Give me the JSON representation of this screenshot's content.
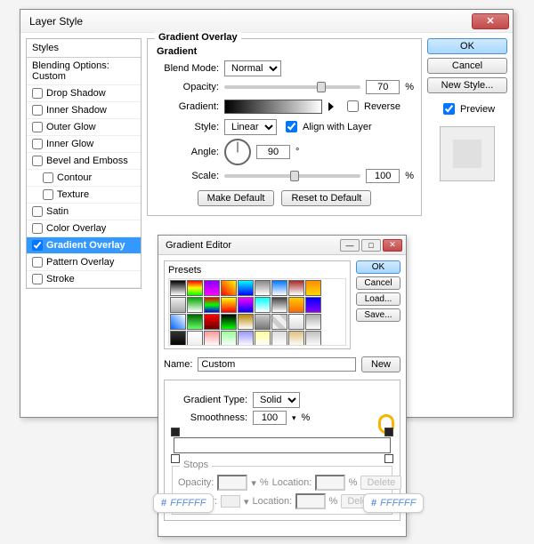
{
  "main": {
    "title": "Layer Style",
    "styles_head": "Styles",
    "blending": "Blending Options: Custom",
    "items": [
      {
        "label": "Drop Shadow",
        "checked": false
      },
      {
        "label": "Inner Shadow",
        "checked": false
      },
      {
        "label": "Outer Glow",
        "checked": false
      },
      {
        "label": "Inner Glow",
        "checked": false
      },
      {
        "label": "Bevel and Emboss",
        "checked": false
      },
      {
        "label": "Contour",
        "checked": false,
        "sub": true
      },
      {
        "label": "Texture",
        "checked": false,
        "sub": true
      },
      {
        "label": "Satin",
        "checked": false
      },
      {
        "label": "Color Overlay",
        "checked": false
      },
      {
        "label": "Gradient Overlay",
        "checked": true,
        "selected": true
      },
      {
        "label": "Pattern Overlay",
        "checked": false
      },
      {
        "label": "Stroke",
        "checked": false
      }
    ],
    "section_title": "Gradient Overlay",
    "section_sub": "Gradient",
    "blend_mode_lbl": "Blend Mode:",
    "blend_mode": "Normal",
    "opacity_lbl": "Opacity:",
    "opacity_val": "70",
    "gradient_lbl": "Gradient:",
    "reverse_lbl": "Reverse",
    "style_lbl": "Style:",
    "style_val": "Linear",
    "align_lbl": "Align with Layer",
    "angle_lbl": "Angle:",
    "angle_val": "90",
    "scale_lbl": "Scale:",
    "scale_val": "100",
    "make_default": "Make Default",
    "reset_default": "Reset to Default",
    "ok": "OK",
    "cancel": "Cancel",
    "new_style": "New Style...",
    "preview_lbl": "Preview",
    "pct": "%",
    "deg": "°"
  },
  "ge": {
    "title": "Gradient Editor",
    "presets_lbl": "Presets",
    "ok": "OK",
    "cancel": "Cancel",
    "load": "Load...",
    "save": "Save...",
    "name_lbl": "Name:",
    "name_val": "Custom",
    "new_btn": "New",
    "gtype_lbl": "Gradient Type:",
    "gtype_val": "Solid",
    "smooth_lbl": "Smoothness:",
    "smooth_val": "100",
    "stops_title": "Stops",
    "opacity_lbl": "Opacity:",
    "location_lbl": "Location:",
    "color_lbl": "Color:",
    "delete_lbl": "Delete",
    "pct": "%",
    "swatches": [
      "linear-gradient(#000,#fff)",
      "linear-gradient(#f00,#ff0,#0f0)",
      "linear-gradient(#80f,#f0f)",
      "linear-gradient(45deg,#f00,#ff0)",
      "linear-gradient(#0ff,#00f)",
      "linear-gradient(#888,#fff)",
      "linear-gradient(#07f,#fff)",
      "linear-gradient(#a52a2a,#fff)",
      "linear-gradient(#ff8c00,#ffd700)",
      "linear-gradient(#eee,#aaa)",
      "linear-gradient(#0a0,#fff)",
      "linear-gradient(#f00,#0f0,#00f)",
      "linear-gradient(#ff0,#f00)",
      "linear-gradient(#f0f,#00f)",
      "linear-gradient(#0ff,#fff)",
      "linear-gradient(#444,#fff)",
      "linear-gradient(#fc0,#f60)",
      "linear-gradient(#00f,#80f)",
      "linear-gradient(45deg,#06f,#fff)",
      "linear-gradient(#060,#6f6)",
      "linear-gradient(#f00,#600)",
      "linear-gradient(#000,#0f0)",
      "linear-gradient(#b8860b,#fff)",
      "linear-gradient(#ccc,#777)",
      "linear-gradient(45deg,#eee 25%,#ccc 25%,#ccc 50%,#eee 50%,#eee 75%,#ccc 75%)",
      "linear-gradient(#fff,#ddd)",
      "linear-gradient(#aaa,#fff)",
      "linear-gradient(#333,#000)",
      "linear-gradient(#fff,#eee)",
      "linear-gradient(#f99,#fff)",
      "linear-gradient(#9f9,#fff)",
      "linear-gradient(#99f,#fff)",
      "linear-gradient(#ff9,#fff)",
      "linear-gradient(#ddd,#fff)",
      "linear-gradient(#e0c080,#fff)",
      "linear-gradient(#c0c0c0,#fff)"
    ]
  },
  "hex": {
    "left": "FFFFFF",
    "right": "FFFFFF"
  }
}
